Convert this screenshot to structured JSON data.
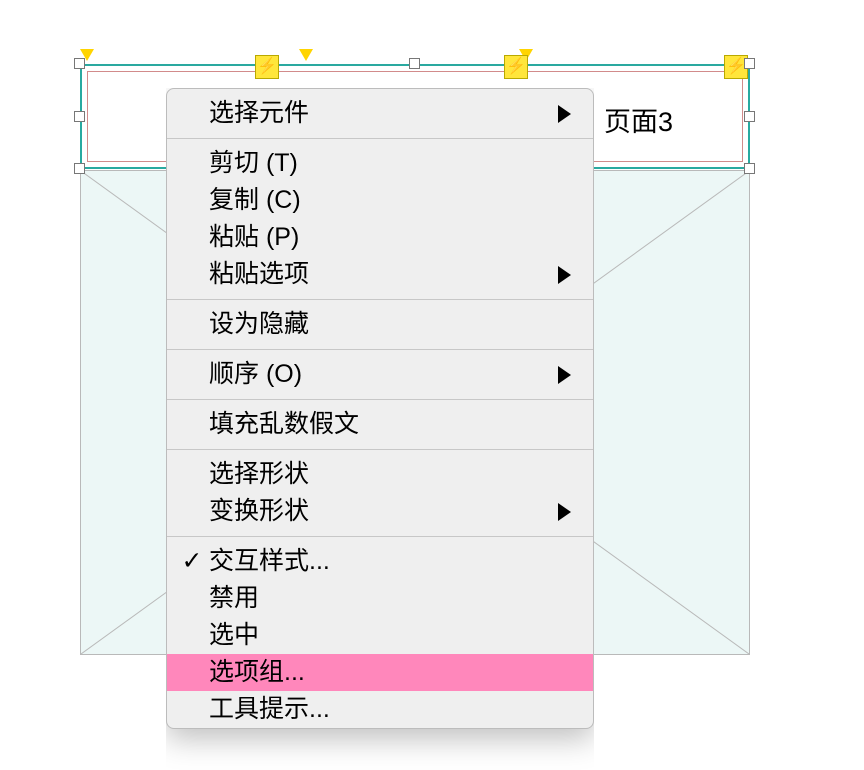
{
  "canvas": {
    "tab_label": "页面3"
  },
  "context_menu": {
    "items": [
      {
        "label": "选择元件",
        "submenu": true
      },
      {
        "sep": true
      },
      {
        "label": "剪切 (T)"
      },
      {
        "label": "复制 (C)"
      },
      {
        "label": "粘贴 (P)"
      },
      {
        "label": "粘贴选项",
        "submenu": true
      },
      {
        "sep": true
      },
      {
        "label": "设为隐藏"
      },
      {
        "sep": true
      },
      {
        "label": "顺序 (O)",
        "submenu": true
      },
      {
        "sep": true
      },
      {
        "label": "填充乱数假文"
      },
      {
        "sep": true
      },
      {
        "label": "选择形状"
      },
      {
        "label": "变换形状",
        "submenu": true
      },
      {
        "sep": true
      },
      {
        "label": "交互样式...",
        "checked": true
      },
      {
        "label": "禁用"
      },
      {
        "label": "选中"
      },
      {
        "label": "选项组...",
        "highlight": true
      },
      {
        "label": "工具提示..."
      }
    ]
  },
  "markers": {
    "bolt_glyph": "⚡"
  }
}
